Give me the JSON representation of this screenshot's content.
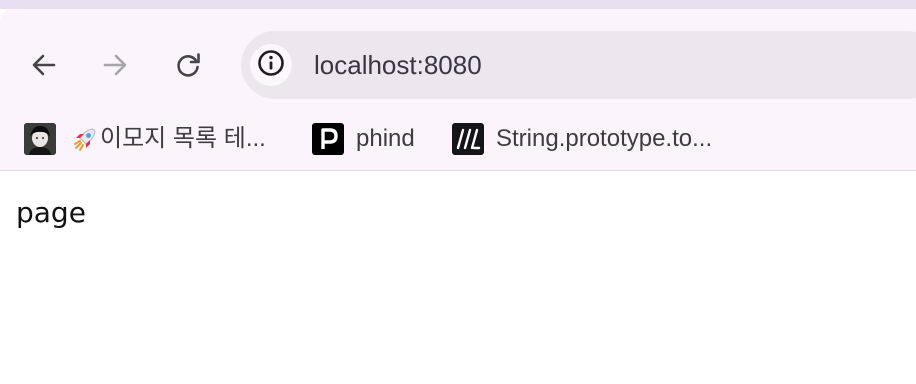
{
  "toolbar": {
    "back_icon": "arrow-left-icon",
    "forward_icon": "arrow-right-icon",
    "reload_icon": "reload-icon"
  },
  "omnibox": {
    "site_info_icon": "info-icon",
    "url": "localhost:8080"
  },
  "bookmarks": [
    {
      "icon": "avatar-photo",
      "label": ""
    },
    {
      "icon": "rocket-icon",
      "label": "이모지 목록 테..."
    },
    {
      "icon": "phind-logo-icon",
      "label": "phind"
    },
    {
      "icon": "mdn-logo-icon",
      "label": "String.prototype.to..."
    }
  ],
  "page": {
    "text": "page"
  },
  "colors": {
    "tab_strip": "#e9dff3",
    "toolbar": "#fbf4fd",
    "omnibox": "#ede6ef",
    "icon": "#47424b",
    "icon_disabled": "#a7a3a9"
  }
}
